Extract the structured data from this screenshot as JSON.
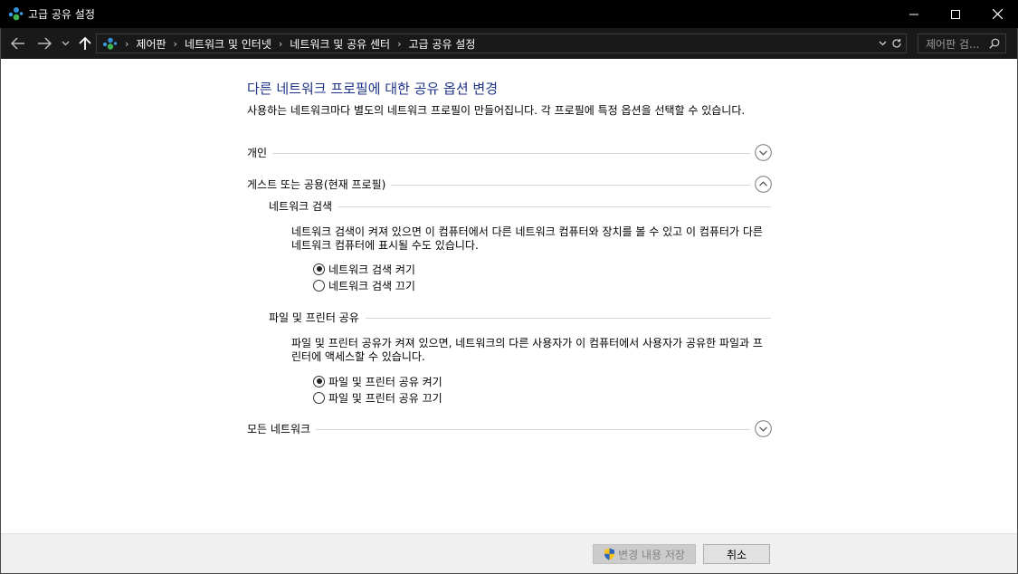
{
  "window": {
    "title": "고급 공유 설정",
    "icon": "network-sharing-icon"
  },
  "nav": {
    "breadcrumbs": [
      "제어판",
      "네트워크 및 인터넷",
      "네트워크 및 공유 센터",
      "고급 공유 설정"
    ],
    "search_placeholder": "제어판 검..."
  },
  "main": {
    "title": "다른 네트워크 프로필에 대한 공유 옵션 변경",
    "description": "사용하는 네트워크마다 별도의 네트워크 프로필이 만들어집니다. 각 프로필에 특정 옵션을 선택할 수 있습니다.",
    "sections": {
      "private": {
        "label": "개인",
        "expanded": false
      },
      "guest": {
        "label": "게스트 또는 공용(현재 프로필)",
        "expanded": true,
        "network_discovery": {
          "label": "네트워크 검색",
          "description": "네트워크 검색이 켜져 있으면 이 컴퓨터에서 다른 네트워크 컴퓨터와 장치를 볼 수 있고 이 컴퓨터가 다른 네트워크 컴퓨터에 표시될 수도 있습니다.",
          "options": [
            {
              "label": "네트워크 검색 켜기",
              "checked": true
            },
            {
              "label": "네트워크 검색 끄기",
              "checked": false
            }
          ]
        },
        "file_printer_sharing": {
          "label": "파일 및 프린터 공유",
          "description": "파일 및 프린터 공유가 켜져 있으면, 네트워크의 다른 사용자가 이 컴퓨터에서 사용자가 공유한 파일과 프린터에 액세스할 수 있습니다.",
          "options": [
            {
              "label": "파일 및 프린터 공유 켜기",
              "checked": true
            },
            {
              "label": "파일 및 프린터 공유 끄기",
              "checked": false
            }
          ]
        }
      },
      "all_networks": {
        "label": "모든 네트워크",
        "expanded": false
      }
    }
  },
  "footer": {
    "save_label": "변경 내용 저장",
    "save_enabled": false,
    "cancel_label": "취소"
  },
  "colors": {
    "title_blue": "#1e3287",
    "titlebar": "#000000",
    "navbar": "#191919",
    "footer": "#f0f0f0"
  }
}
